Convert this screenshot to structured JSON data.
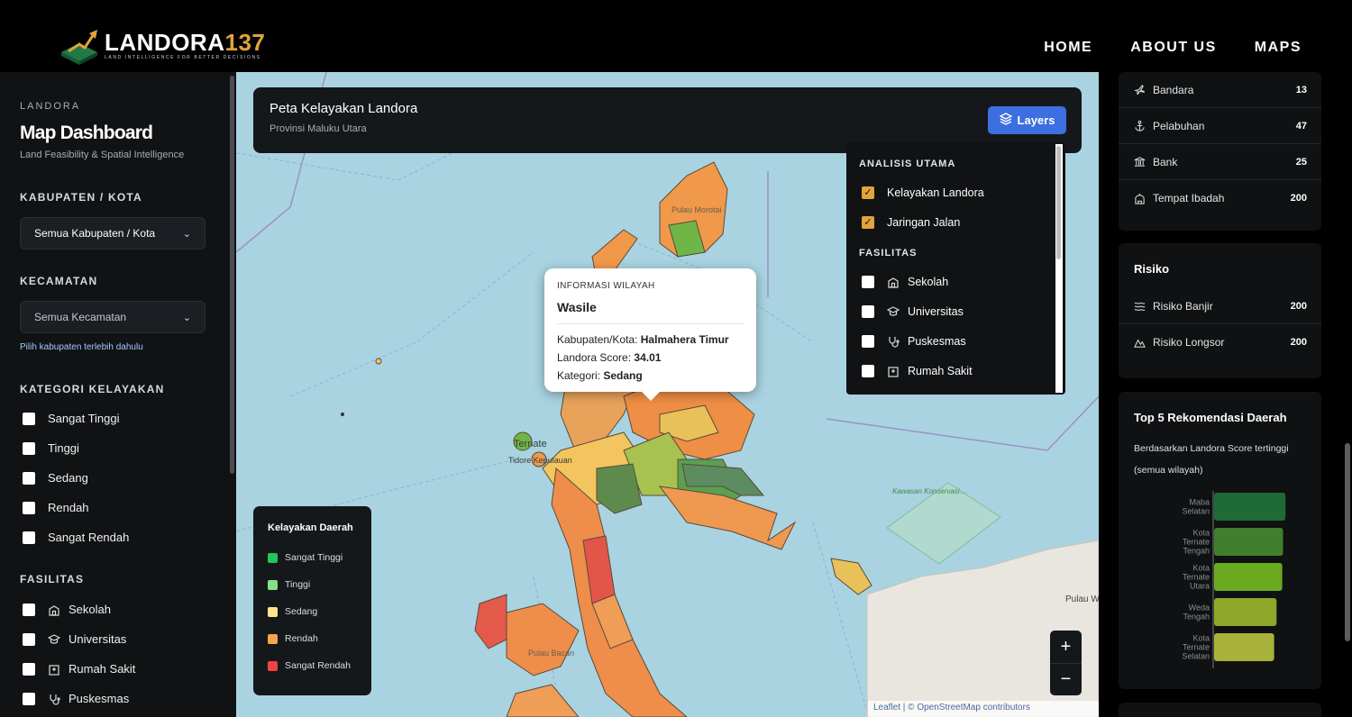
{
  "brand": {
    "name": "LANDORA",
    "number": "137",
    "tagline": "LAND INTELLIGENCE FOR BETTER DECISIONS"
  },
  "nav": [
    {
      "label": "HOME"
    },
    {
      "label": "ABOUT US"
    },
    {
      "label": "MAPS"
    }
  ],
  "sidebar": {
    "eyebrow": "LANDORA",
    "title": "Map Dashboard",
    "subtitle": "Land Feasibility & Spatial Intelligence",
    "kabupaten": {
      "label": "KABUPATEN / KOTA",
      "value": "Semua Kabupaten / Kota"
    },
    "kecamatan": {
      "label": "KECAMATAN",
      "value": "Semua Kecamatan",
      "hint": "Pilih kabupaten terlebih dahulu"
    },
    "kategori": {
      "label": "KATEGORI KELAYAKAN",
      "items": [
        "Sangat Tinggi",
        "Tinggi",
        "Sedang",
        "Rendah",
        "Sangat Rendah"
      ]
    },
    "fasilitas": {
      "label": "FASILITAS",
      "items": [
        {
          "label": "Sekolah",
          "icon": "school-icon"
        },
        {
          "label": "Universitas",
          "icon": "graduation-cap-icon"
        },
        {
          "label": "Rumah Sakit",
          "icon": "hospital-icon"
        },
        {
          "label": "Puskesmas",
          "icon": "stethoscope-icon"
        }
      ]
    }
  },
  "map": {
    "header_title": "Peta Kelayakan Landora",
    "header_subtitle": "Provinsi Maluku Utara",
    "layers_button": "Layers",
    "place_labels": [
      "Pulau Morotai",
      "Ternate",
      "Tidore Kepulauan",
      "Pulau Bacan",
      "Kawasan Konservasi Suaka Alam Perairan Waigeo Sebelah Barat",
      "Pulau W"
    ],
    "layers_panel": {
      "analisis_title": "ANALISIS UTAMA",
      "analisis": [
        {
          "label": "Kelayakan Landora",
          "checked": true
        },
        {
          "label": "Jaringan Jalan",
          "checked": true
        }
      ],
      "fasilitas_title": "FASILITAS",
      "fasilitas": [
        {
          "label": "Sekolah",
          "icon": "school-icon"
        },
        {
          "label": "Universitas",
          "icon": "graduation-cap-icon"
        },
        {
          "label": "Puskesmas",
          "icon": "stethoscope-icon"
        },
        {
          "label": "Rumah Sakit",
          "icon": "hospital-icon"
        }
      ]
    },
    "popup": {
      "eyebrow": "INFORMASI WILAYAH",
      "title": "Wasile",
      "kab_label": "Kabupaten/Kota:",
      "kab_value": "Halmahera Timur",
      "score_label": "Landora Score:",
      "score_value": "34.01",
      "cat_label": "Kategori:",
      "cat_value": "Sedang"
    },
    "legend": {
      "title": "Kelayakan Daerah",
      "items": [
        {
          "label": "Sangat Tinggi",
          "color": "#22c55e"
        },
        {
          "label": "Tinggi",
          "color": "#86e08a"
        },
        {
          "label": "Sedang",
          "color": "#fde68a"
        },
        {
          "label": "Rendah",
          "color": "#f5a54a"
        },
        {
          "label": "Sangat Rendah",
          "color": "#ef4444"
        }
      ]
    },
    "zoom_in": "+",
    "zoom_out": "−",
    "attribution": "Leaflet | © OpenStreetMap contributors"
  },
  "right": {
    "facilities": [
      {
        "label": "Bandara",
        "value": "13",
        "icon": "plane-icon"
      },
      {
        "label": "Pelabuhan",
        "value": "47",
        "icon": "anchor-icon"
      },
      {
        "label": "Bank",
        "value": "25",
        "icon": "bank-icon"
      },
      {
        "label": "Tempat Ibadah",
        "value": "200",
        "icon": "mosque-icon"
      }
    ],
    "risiko": {
      "title": "Risiko",
      "items": [
        {
          "label": "Risiko Banjir",
          "value": "200",
          "icon": "water-icon"
        },
        {
          "label": "Risiko Longsor",
          "value": "200",
          "icon": "mountain-icon"
        }
      ]
    },
    "top5": {
      "title": "Top 5 Rekomendasi Daerah",
      "subtitle": "Berdasarkan Landora Score tertinggi (semua wilayah)"
    }
  },
  "chart_data": {
    "type": "bar",
    "orientation": "horizontal",
    "categories": [
      "Maba Selatan",
      "Kota Ternate Tengah",
      "Kota Ternate Utara",
      "Weda Tengah",
      "Kota Ternate Selatan"
    ],
    "values": [
      88,
      85,
      84,
      77,
      74
    ],
    "colors": [
      "#1f6b35",
      "#3f7f2e",
      "#6aaa1f",
      "#8fa82a",
      "#a8b23a"
    ]
  }
}
